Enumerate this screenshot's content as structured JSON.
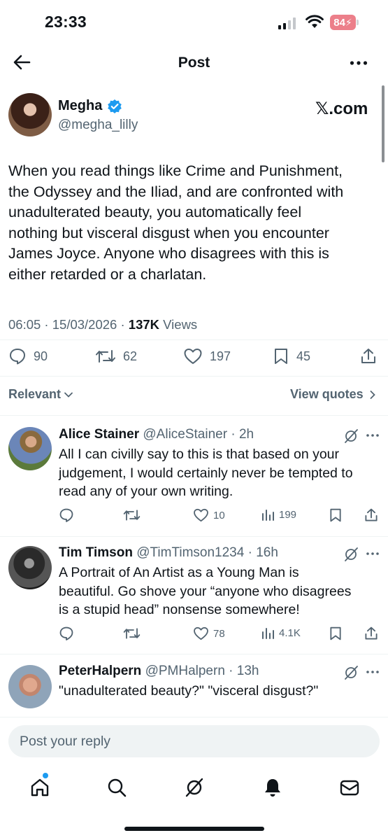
{
  "status_bar": {
    "time": "23:33",
    "battery": "84"
  },
  "header": {
    "title": "Post"
  },
  "post": {
    "author_name": "Megha",
    "author_handle": "@megha_lilly",
    "source_label": "𝕏.com",
    "text_lines": [
      "When you read things like Crime and Punishment,",
      "the Odyssey and the Iliad, and are confronted with",
      "unadulterated beauty, you automatically feel",
      "nothing but visceral disgust when you encounter",
      "James Joyce. Anyone who disagrees with this is",
      "either retarded or a charlatan."
    ],
    "time": "06:05",
    "date": "15/03/2026",
    "views_count": "137K",
    "views_label": "Views",
    "replies": "90",
    "reposts": "62",
    "likes": "197",
    "bookmarks": "45"
  },
  "sort": {
    "label": "Relevant",
    "view_quotes": "View quotes"
  },
  "replies": [
    {
      "name": "Alice Stainer",
      "handle": "@AliceStainer",
      "age": "2h",
      "lines": [
        "All I can civilly say to this is that based on your",
        "judgement, I would certainly never be tempted to",
        "read any of your own writing."
      ],
      "likes": "10",
      "views": "199"
    },
    {
      "name": "Tim Timson",
      "handle": "@TimTimson1234",
      "age": "16h",
      "lines": [
        "A Portrait of An Artist as a Young Man is",
        "beautiful. Go shove your “anyone who disagrees",
        "is a stupid head” nonsense somewhere!"
      ],
      "likes": "78",
      "views": "4.1K"
    },
    {
      "name": "PeterHalpern",
      "handle": "@PMHalpern",
      "age": "13h",
      "lines": [
        "\"unadulterated beauty?\" \"visceral disgust?\""
      ]
    }
  ],
  "reply_box": {
    "placeholder": "Post your reply"
  },
  "colors": {
    "accent": "#1d9bf0",
    "muted": "#536471",
    "text": "#0f1419",
    "battery": "#ec7f8a"
  }
}
